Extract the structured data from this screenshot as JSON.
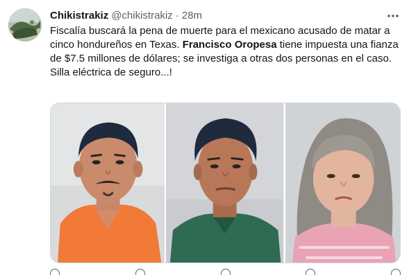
{
  "tweet": {
    "display_name": "Chikistrakiz",
    "handle": "@chikistrakiz",
    "separator": "·",
    "time": "28m",
    "text": {
      "part1": "Fiscalía buscará la pena de muerte para el mexicano acusado de matar a cinco hondureños en Texas. ",
      "bold_name": "Francisco Oropesa",
      "part2": " tiene impuesta una fianza de $7.5 millones de dólares; se investiga a otras dos personas en el caso.",
      "line2": "Silla eléctrica de seguro...!"
    },
    "media": {
      "photos": [
        {
          "subject": "mugshot-man-orange-shirt",
          "shirt_color": "#f07a36",
          "bg_color": "#d9dadc"
        },
        {
          "subject": "mugshot-man-green-shirt",
          "shirt_color": "#2f6b52",
          "bg_color": "#c9cbd0"
        },
        {
          "subject": "mugshot-woman-gray-hair",
          "shirt_color": "#e9a3b4",
          "bg_color": "#cfd3d6"
        }
      ]
    }
  },
  "icons": {
    "more": "more-horizontal-icon"
  },
  "colors": {
    "text": "#0f1419",
    "secondary": "#536471",
    "border": "#cfd9de"
  }
}
